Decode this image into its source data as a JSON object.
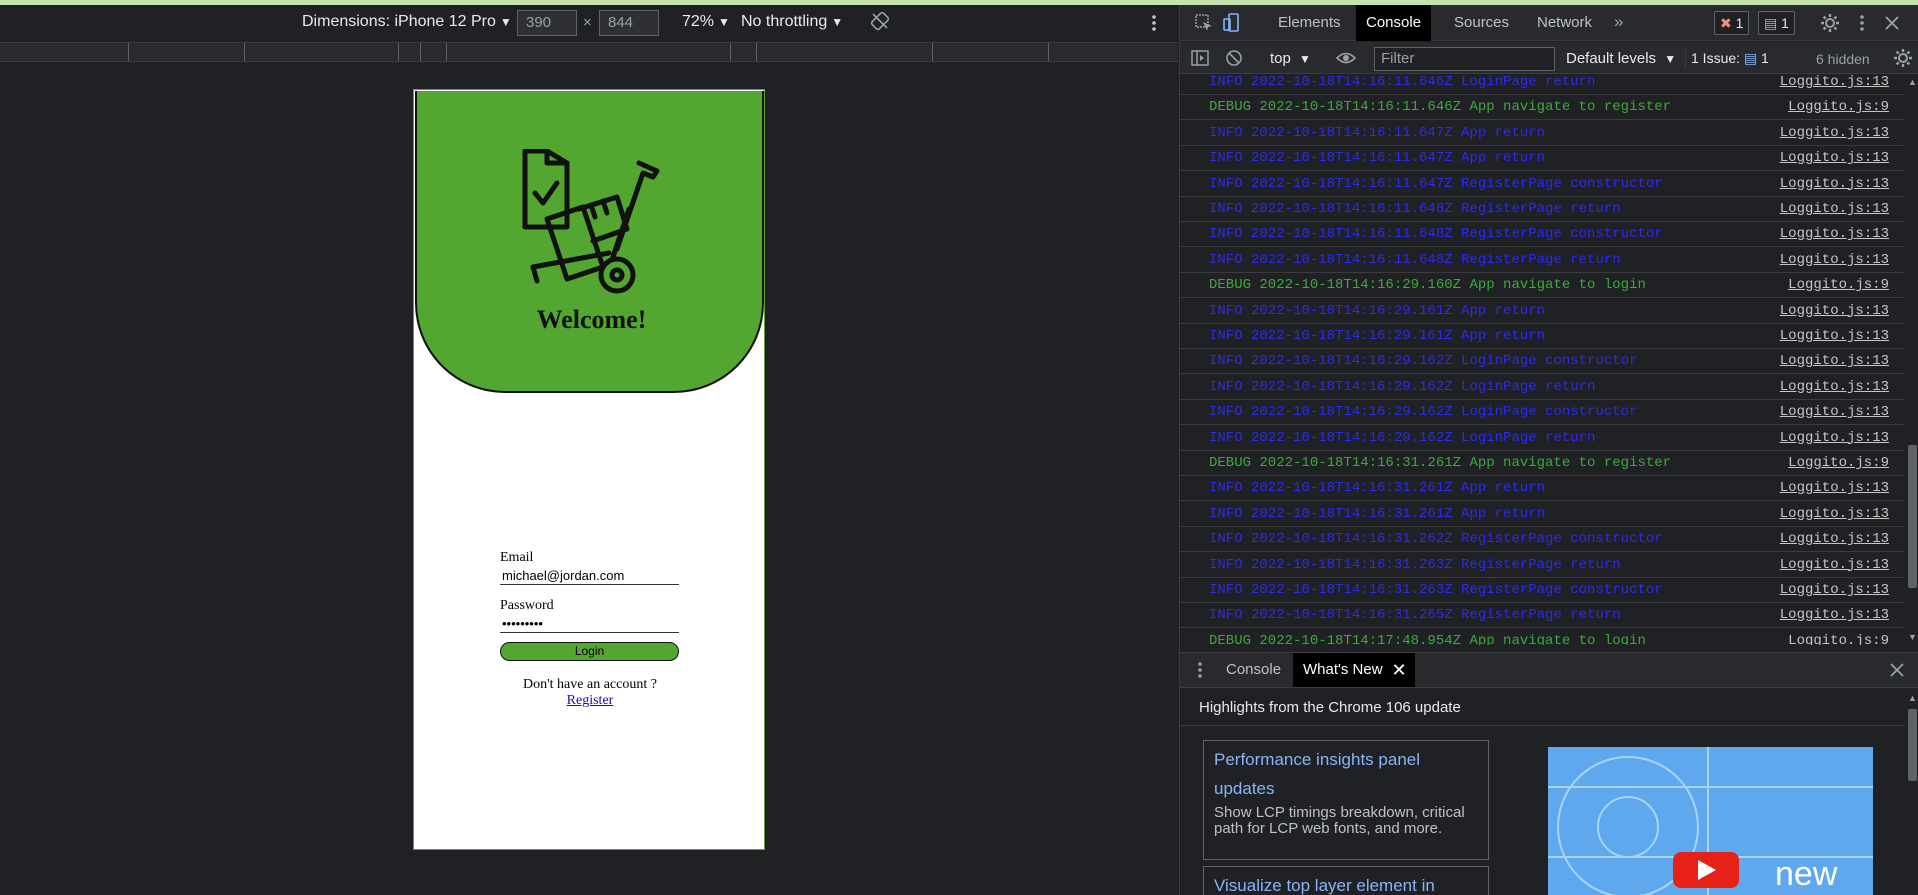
{
  "device_toolbar": {
    "dimensions_label": "Dimensions: iPhone 12 Pro",
    "width": "390",
    "height": "844",
    "zoom": "72%",
    "throttling": "No throttling"
  },
  "app": {
    "welcome": "Welcome!",
    "email_label": "Email",
    "email_value": "michael@jordan.com",
    "password_label": "Password",
    "password_value": "•••••••••",
    "login_button": "Login",
    "no_account_text": "Don't have an account ?",
    "register_link": "Register",
    "brand_color": "#53a630"
  },
  "devtools": {
    "tabs": [
      "Elements",
      "Console",
      "Sources",
      "Network"
    ],
    "active_tab": "Console",
    "errors_count": "1",
    "messages_count": "1",
    "context": "top",
    "filter_placeholder": "Filter",
    "levels": "Default levels",
    "issues": "1 Issue:",
    "issues_count": "1",
    "hidden": "6 hidden",
    "logs": [
      {
        "level": "info",
        "msg": "INFO 2022-10-18T14:16:11.646Z LoginPage return",
        "src": "Loggito.js:13"
      },
      {
        "level": "debug",
        "msg": "DEBUG 2022-10-18T14:16:11.646Z App navigate to register",
        "src": "Loggito.js:9"
      },
      {
        "level": "info",
        "msg": "INFO 2022-10-18T14:16:11.647Z App return",
        "src": "Loggito.js:13"
      },
      {
        "level": "info",
        "msg": "INFO 2022-10-18T14:16:11.647Z App return",
        "src": "Loggito.js:13"
      },
      {
        "level": "info",
        "msg": "INFO 2022-10-18T14:16:11.647Z RegisterPage constructor",
        "src": "Loggito.js:13"
      },
      {
        "level": "info",
        "msg": "INFO 2022-10-18T14:16:11.648Z RegisterPage return",
        "src": "Loggito.js:13"
      },
      {
        "level": "info",
        "msg": "INFO 2022-10-18T14:16:11.648Z RegisterPage constructor",
        "src": "Loggito.js:13"
      },
      {
        "level": "info",
        "msg": "INFO 2022-10-18T14:16:11.648Z RegisterPage return",
        "src": "Loggito.js:13"
      },
      {
        "level": "debug",
        "msg": "DEBUG 2022-10-18T14:16:29.160Z App navigate to login",
        "src": "Loggito.js:9"
      },
      {
        "level": "info",
        "msg": "INFO 2022-10-18T14:16:29.161Z App return",
        "src": "Loggito.js:13"
      },
      {
        "level": "info",
        "msg": "INFO 2022-10-18T14:16:29.161Z App return",
        "src": "Loggito.js:13"
      },
      {
        "level": "info",
        "msg": "INFO 2022-10-18T14:16:29.162Z LoginPage constructor",
        "src": "Loggito.js:13"
      },
      {
        "level": "info",
        "msg": "INFO 2022-10-18T14:16:29.162Z LoginPage return",
        "src": "Loggito.js:13"
      },
      {
        "level": "info",
        "msg": "INFO 2022-10-18T14:16:29.162Z LoginPage constructor",
        "src": "Loggito.js:13"
      },
      {
        "level": "info",
        "msg": "INFO 2022-10-18T14:16:29.162Z LoginPage return",
        "src": "Loggito.js:13"
      },
      {
        "level": "debug",
        "msg": "DEBUG 2022-10-18T14:16:31.261Z App navigate to register",
        "src": "Loggito.js:9"
      },
      {
        "level": "info",
        "msg": "INFO 2022-10-18T14:16:31.261Z App return",
        "src": "Loggito.js:13"
      },
      {
        "level": "info",
        "msg": "INFO 2022-10-18T14:16:31.261Z App return",
        "src": "Loggito.js:13"
      },
      {
        "level": "info",
        "msg": "INFO 2022-10-18T14:16:31.262Z RegisterPage constructor",
        "src": "Loggito.js:13"
      },
      {
        "level": "info",
        "msg": "INFO 2022-10-18T14:16:31.263Z RegisterPage return",
        "src": "Loggito.js:13"
      },
      {
        "level": "info",
        "msg": "INFO 2022-10-18T14:16:31.263Z RegisterPage constructor",
        "src": "Loggito.js:13"
      },
      {
        "level": "info",
        "msg": "INFO 2022-10-18T14:16:31.265Z RegisterPage return",
        "src": "Loggito.js:13"
      },
      {
        "level": "debug",
        "msg": "DEBUG 2022-10-18T14:17:48.954Z App navigate to login",
        "src": "Loggito.js:9"
      }
    ],
    "drawer_tabs": [
      "Console",
      "What's New"
    ],
    "drawer_active": "What's New",
    "whats_new_title": "Highlights from the Chrome 106 update",
    "cards": [
      {
        "title": "Performance insights panel updates",
        "body": "Show LCP timings breakdown, critical path for LCP web fonts, and more."
      },
      {
        "title": "Visualize top layer element in",
        "body": ""
      }
    ],
    "video_caption": "new"
  }
}
